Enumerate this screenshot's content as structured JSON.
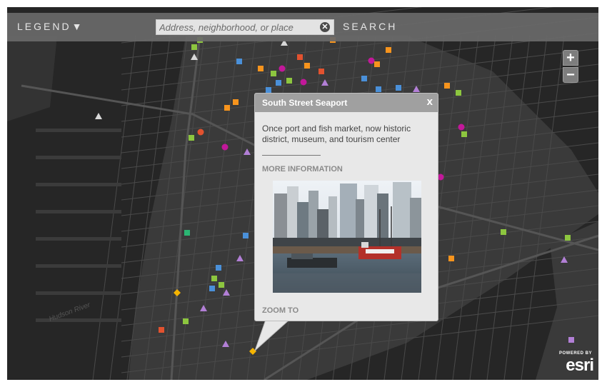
{
  "toolbar": {
    "legend_label": "LEGEND",
    "legend_arrow": "▼",
    "search_placeholder": "Address, neighborhood, or place",
    "clear_glyph": "✕",
    "search_label": "SEARCH"
  },
  "zoom": {
    "in_label": "+",
    "out_label": "−"
  },
  "popup": {
    "title": "South Street Seaport",
    "close_label": "x",
    "description": "Once port and fish market, now historic district, museum, and tourism center",
    "more_info_label": "MORE INFORMATION",
    "zoom_to_label": "ZOOM TO"
  },
  "labels": {
    "river": "Hudson River"
  },
  "attribution": {
    "powered_by": "POWERED BY",
    "brand": "esri"
  },
  "icons": {
    "legend_toggle": "chevron-down-icon",
    "clear_search": "clear-icon",
    "zoom_in": "plus-icon",
    "zoom_out": "minus-icon",
    "popup_close": "close-icon"
  },
  "colors": {
    "map_background": "#2d2d2d",
    "water": "#262626",
    "land": "#3a3a3a",
    "marker_green": "#8dc63f",
    "marker_blue": "#4a90d9",
    "marker_orange": "#f7941d",
    "marker_red": "#e2522f",
    "marker_purple": "#b27fd6",
    "marker_magenta": "#c2189a",
    "marker_yellow": "#f5b400",
    "marker_teal": "#2bb673",
    "marker_white": "#d8d8d8"
  }
}
